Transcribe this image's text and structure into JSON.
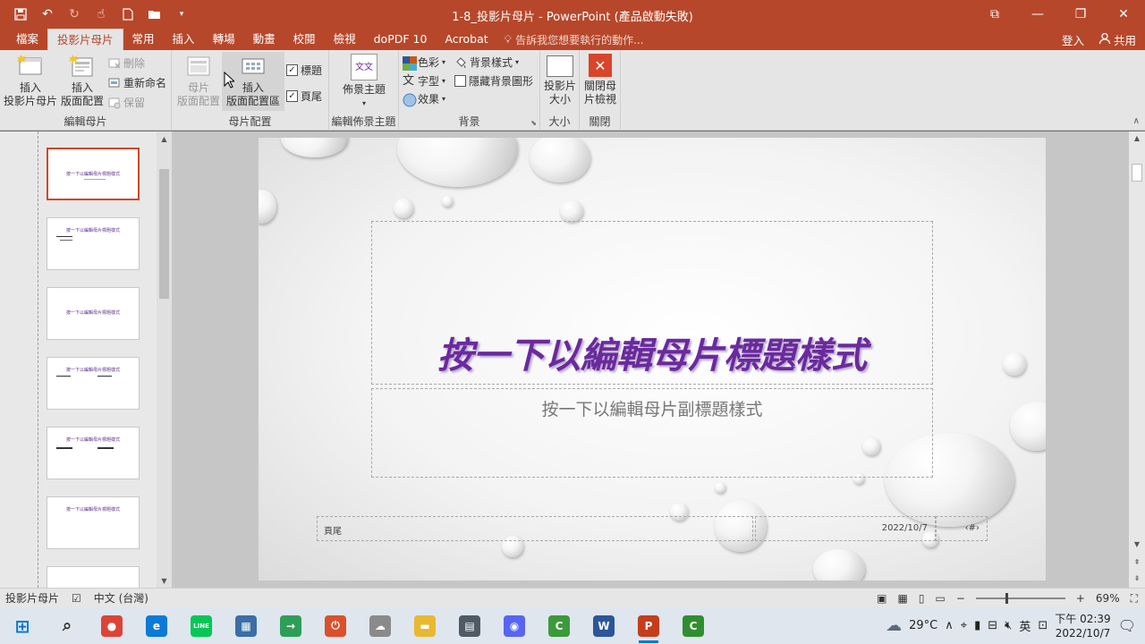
{
  "window": {
    "title": "1-8_投影片母片 - PowerPoint (產品啟動失敗)",
    "qat": [
      "save-icon",
      "undo-icon",
      "redo-icon",
      "touch-mode-icon",
      "new-file-icon",
      "open-folder-icon",
      "customize-qat-icon"
    ],
    "controls": {
      "ribbon_display": "⧉",
      "minimize": "—",
      "restore": "❐",
      "close": "✕"
    }
  },
  "tabs": [
    {
      "label": "檔案"
    },
    {
      "label": "投影片母片",
      "active": true
    },
    {
      "label": "常用"
    },
    {
      "label": "插入"
    },
    {
      "label": "轉場"
    },
    {
      "label": "動畫"
    },
    {
      "label": "校閱"
    },
    {
      "label": "檢視"
    },
    {
      "label": "doPDF 10"
    },
    {
      "label": "Acrobat"
    }
  ],
  "tell_me": "告訴我您想要執行的動作...",
  "account": {
    "signin": "登入",
    "share": "共用"
  },
  "ribbon": {
    "edit_master": {
      "label": "編輯母片",
      "insert_slide_master": [
        "插入",
        "投影片母片"
      ],
      "insert_layout": [
        "插入",
        "版面配置"
      ],
      "delete": "刪除",
      "rename": "重新命名",
      "preserve": "保留"
    },
    "master_layout": {
      "label": "母片配置",
      "master_layout_btn": [
        "母片",
        "版面配置"
      ],
      "insert_placeholder": [
        "插入",
        "版面配置區"
      ],
      "title_check": "標題",
      "footer_check": "頁尾"
    },
    "edit_theme": {
      "label": "編輯佈景主題",
      "themes": "佈景主題",
      "theme_icon_text": "文文"
    },
    "background": {
      "label": "背景",
      "colors": "色彩",
      "fonts": "字型",
      "effects": "效果",
      "bg_styles": "背景樣式",
      "hide_bg": "隱藏背景圖形"
    },
    "size": {
      "label": "大小",
      "slide_size": [
        "投影片",
        "大小"
      ]
    },
    "close": {
      "label": "關閉",
      "close_master": [
        "關閉母",
        "片檢視"
      ]
    }
  },
  "thumbnails": [
    {
      "title": "按一下以編輯母片標題樣式",
      "selected": true
    },
    {
      "title": "按一下以編輯母片標題樣式"
    },
    {
      "title": "按一下以編輯母片標題樣式"
    },
    {
      "title": "按一下以編輯母片標題樣式"
    },
    {
      "title": "按一下以編輯母片標題樣式"
    },
    {
      "title": "按一下以編輯母片標題樣式"
    }
  ],
  "slide": {
    "title": "按一下以編輯母片標題樣式",
    "subtitle": "按一下以編輯母片副標題樣式",
    "footer": "頁尾",
    "date": "2022/10/7",
    "page_num": "‹#›"
  },
  "status": {
    "view": "投影片母片",
    "language": "中文 (台灣)",
    "zoom": "69%",
    "zoom_value": 0.69
  },
  "taskbar": {
    "apps": [
      {
        "name": "start",
        "color": "#0078d4",
        "glyph": "⊞"
      },
      {
        "name": "search",
        "color": "#333333",
        "glyph": "⌕"
      },
      {
        "name": "chrome",
        "color": "#db4437",
        "glyph": "●"
      },
      {
        "name": "edge",
        "color": "#0a7bd7",
        "glyph": "e"
      },
      {
        "name": "line",
        "color": "#06c755",
        "glyph": "LINE"
      },
      {
        "name": "store",
        "color": "#3a6ea5",
        "glyph": "▦"
      },
      {
        "name": "sign-in-app",
        "color": "#2e9e57",
        "glyph": "→"
      },
      {
        "name": "power-app",
        "color": "#d9502b",
        "glyph": "⏻"
      },
      {
        "name": "cloud-app",
        "color": "#8a8a8a",
        "glyph": "☁"
      },
      {
        "name": "file-explorer",
        "color": "#e8b830",
        "glyph": "▬"
      },
      {
        "name": "calculator",
        "color": "#505a66",
        "glyph": "▤"
      },
      {
        "name": "discord",
        "color": "#5865f2",
        "glyph": "◉"
      },
      {
        "name": "camtasia",
        "color": "#3b9a3b",
        "glyph": "C"
      },
      {
        "name": "word",
        "color": "#2b579a",
        "glyph": "W"
      },
      {
        "name": "powerpoint",
        "color": "#c43e1c",
        "glyph": "P",
        "active": true
      },
      {
        "name": "camtasia-2",
        "color": "#2f8f2f",
        "glyph": "C"
      }
    ],
    "weather": "29°C",
    "ime": "英",
    "time": "下午 02:39",
    "date": "2022/10/7"
  }
}
